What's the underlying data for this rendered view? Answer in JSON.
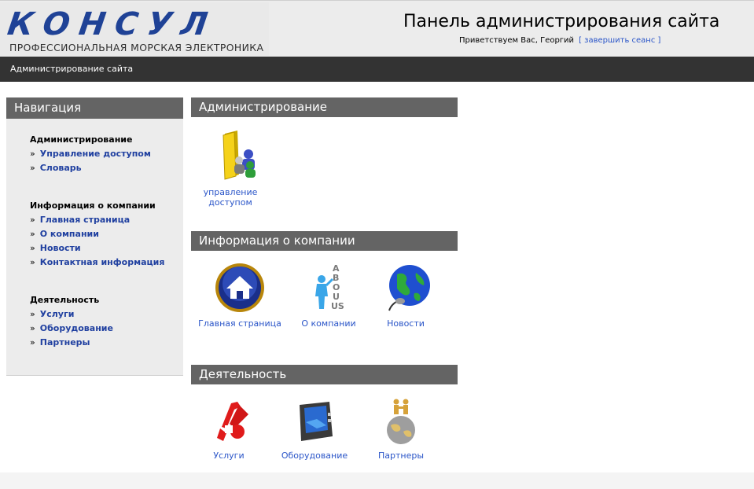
{
  "header": {
    "logo_word": "КОНСУЛ",
    "logo_sub": "ПРОФЕССИОНАЛЬНАЯ МОРСКАЯ ЭЛЕКТРОНИКА",
    "title": "Панель администрирования сайта",
    "greeting": "Приветствуем Вас, Георгий",
    "logout": "[ завершить сеанс ]"
  },
  "topbar": {
    "label": "Администрирование сайта"
  },
  "nav": {
    "title": "Навигация",
    "groups": [
      {
        "title": "Администрирование",
        "items": [
          "Управление доступом",
          "Словарь"
        ]
      },
      {
        "title": "Информация о компании",
        "items": [
          "Главная страница",
          "О компании",
          "Новости",
          "Контактная информация"
        ]
      },
      {
        "title": "Деятельность",
        "items": [
          "Услуги",
          "Оборудование",
          "Партнеры"
        ]
      }
    ]
  },
  "sections": [
    {
      "title": "Администрирование",
      "tiles": [
        {
          "label": "управление доступом",
          "icon": "folder-users-icon"
        }
      ]
    },
    {
      "title": "Информация о компании",
      "tiles": [
        {
          "label": "Главная страница",
          "icon": "home-icon"
        },
        {
          "label": "О компании",
          "icon": "about-us-icon"
        },
        {
          "label": "Новости",
          "icon": "globe-icon"
        }
      ]
    },
    {
      "title": "Деятельность",
      "tiles": [
        {
          "label": "Услуги",
          "icon": "tools-icon"
        },
        {
          "label": "Оборудование",
          "icon": "monitor-icon"
        },
        {
          "label": "Партнеры",
          "icon": "partners-globe-icon"
        }
      ]
    }
  ],
  "colors": {
    "accent_link": "#2a55c8",
    "nav_link": "#2040a0",
    "header_bar": "#333333",
    "section_bar": "#646464",
    "logo": "#1f4296"
  }
}
